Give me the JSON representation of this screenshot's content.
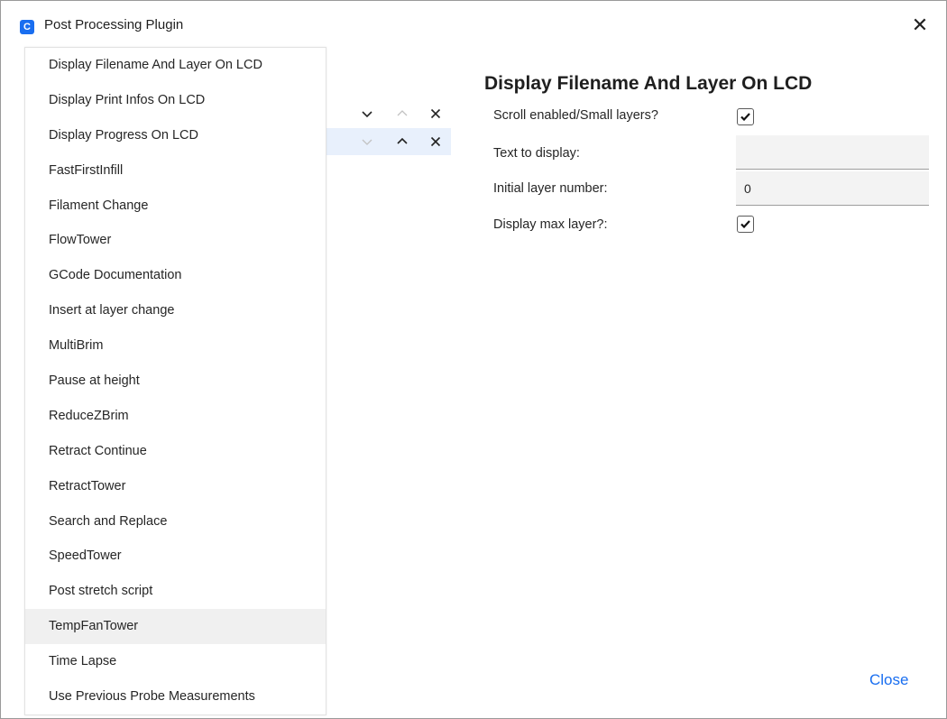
{
  "window": {
    "title": "Post Processing Plugin",
    "app_icon_letter": "C",
    "close_glyph": "✕"
  },
  "script_list": [
    {
      "label": "Display Filename And Layer On LCD"
    },
    {
      "label": "Display Print Infos On LCD"
    },
    {
      "label": "Display Progress On LCD"
    },
    {
      "label": "FastFirstInfill"
    },
    {
      "label": "Filament Change"
    },
    {
      "label": "FlowTower"
    },
    {
      "label": "GCode Documentation"
    },
    {
      "label": "Insert at layer change"
    },
    {
      "label": "MultiBrim"
    },
    {
      "label": "Pause at height"
    },
    {
      "label": "ReduceZBrim"
    },
    {
      "label": "Retract Continue"
    },
    {
      "label": "RetractTower"
    },
    {
      "label": "Search and Replace"
    },
    {
      "label": "SpeedTower"
    },
    {
      "label": "Post stretch script"
    },
    {
      "label": "TempFanTower"
    },
    {
      "label": "Time Lapse"
    },
    {
      "label": "Use Previous Probe Measurements"
    }
  ],
  "hovered_item": "TempFanTower",
  "active_scripts": [
    {
      "move_down_enabled": true,
      "move_up_enabled": false,
      "selected": false
    },
    {
      "move_down_enabled": false,
      "move_up_enabled": true,
      "selected": true
    }
  ],
  "settings": {
    "title": "Display Filename And Layer On LCD",
    "scroll_label": "Scroll enabled/Small layers?",
    "scroll_checked": true,
    "text_label": "Text to display:",
    "text_value": "",
    "initial_layer_label": "Initial layer number:",
    "initial_layer_value": "0",
    "max_layer_label": "Display max layer?:",
    "max_layer_checked": true
  },
  "close_button": "Close",
  "colors": {
    "accent": "#196ef0",
    "selected_row": "#e8f0fc",
    "hover_item": "#f0f0f0"
  },
  "icons": [
    "chevron-down-icon",
    "chevron-up-icon",
    "remove-x-icon",
    "checkmark-icon",
    "close-icon"
  ]
}
